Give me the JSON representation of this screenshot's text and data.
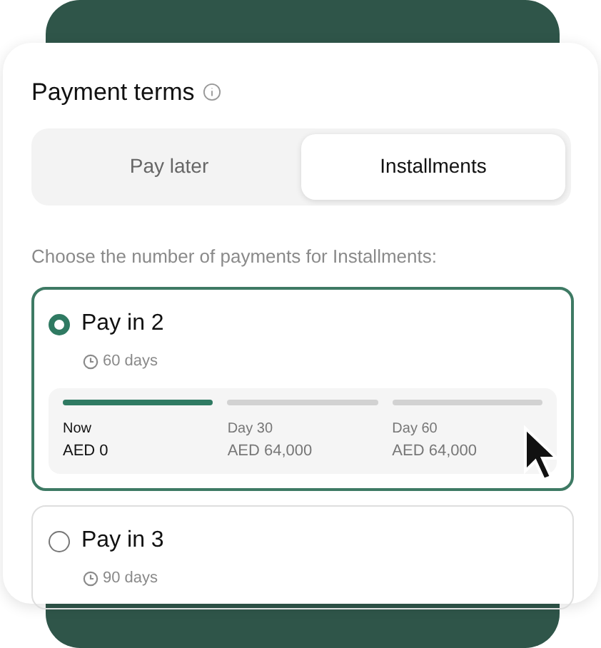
{
  "title": "Payment terms",
  "tabs": [
    {
      "label": "Pay later",
      "selected": false
    },
    {
      "label": "Installments",
      "selected": true
    }
  ],
  "prompt": "Choose the number of payments for Installments:",
  "options": [
    {
      "label": "Pay in 2",
      "duration": "60 days",
      "selected": true,
      "schedule": [
        {
          "when": "Now",
          "amount": "AED 0",
          "active": true
        },
        {
          "when": "Day 30",
          "amount": "AED 64,000",
          "active": false
        },
        {
          "when": "Day 60",
          "amount": "AED 64,000",
          "active": false
        }
      ]
    },
    {
      "label": "Pay in 3",
      "duration": "90 days",
      "selected": false
    }
  ]
}
